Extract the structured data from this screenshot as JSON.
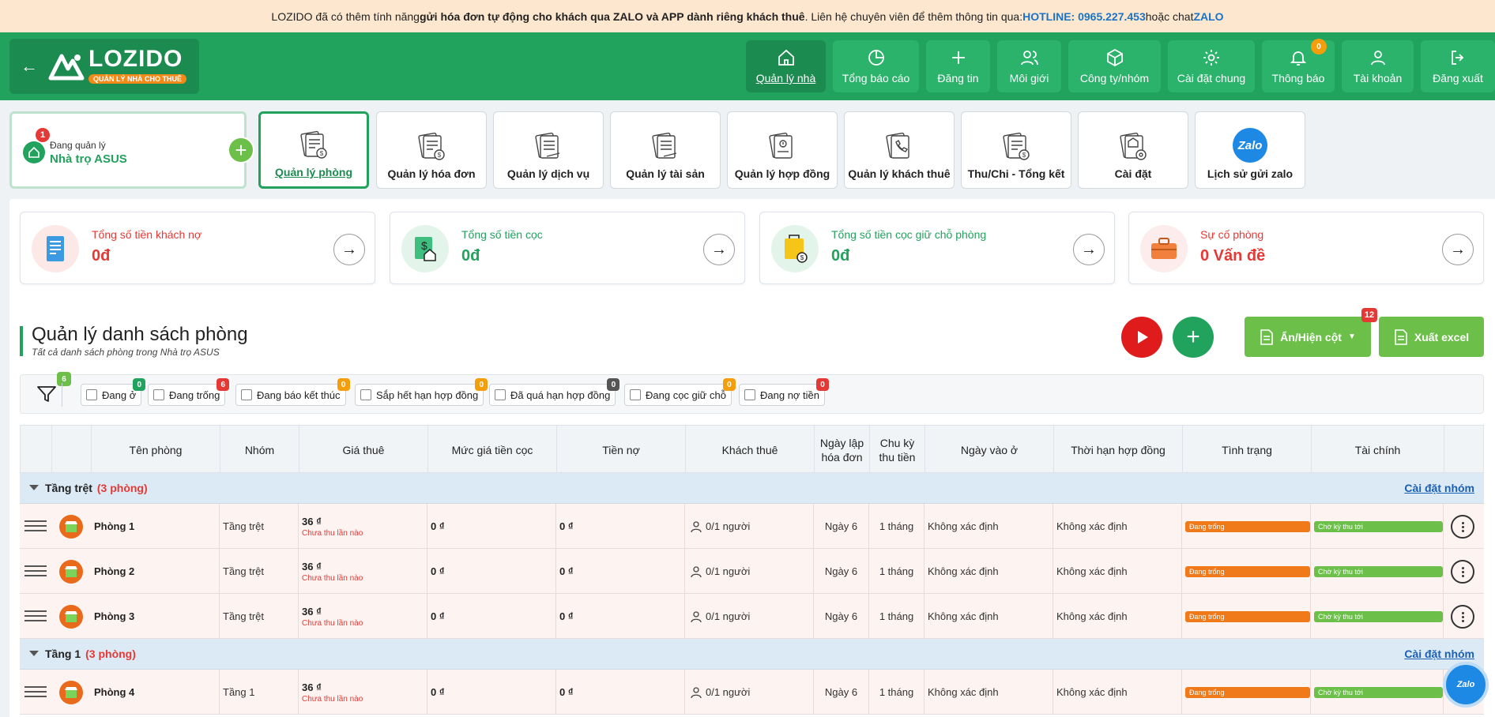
{
  "banner": {
    "prefix": "LOZIDO đã có thêm tính năng ",
    "bold": "gửi hóa đơn tự động cho khách qua ZALO và APP dành riêng khách thuê",
    "middle": ". Liên hệ chuyên viên để thêm thông tin qua: ",
    "hotline": "HOTLINE: 0965.227.453",
    "or": " hoặc chat ",
    "zalo": "ZALO"
  },
  "logo": {
    "name": "LOZIDO",
    "tagline": "QUẢN LÝ NHÀ CHO THUÊ"
  },
  "nav": [
    {
      "label": "Quản lý nhà",
      "icon": "home-icon"
    },
    {
      "label": "Tổng báo cáo",
      "icon": "pie-chart-icon"
    },
    {
      "label": "Đăng tin",
      "icon": "plus-icon"
    },
    {
      "label": "Môi giới",
      "icon": "users-icon"
    },
    {
      "label": "Công ty/nhóm",
      "icon": "box-icon"
    },
    {
      "label": "Cài đặt chung",
      "icon": "gear-icon"
    },
    {
      "label": "Thông báo",
      "icon": "bell-icon",
      "badge": "0"
    },
    {
      "label": "Tài khoản",
      "icon": "user-icon"
    },
    {
      "label": "Đăng xuất",
      "icon": "logout-icon"
    }
  ],
  "house": {
    "badge": "1",
    "sub": "Đang quản lý",
    "name": "Nhà trọ ASUS"
  },
  "tools": [
    {
      "label": "Quản lý phòng",
      "icon": "room-doc-icon"
    },
    {
      "label": "Quản lý hóa đơn",
      "icon": "invoice-icon"
    },
    {
      "label": "Quản lý dịch vụ",
      "icon": "service-icon"
    },
    {
      "label": "Quản lý tài sản",
      "icon": "asset-icon"
    },
    {
      "label": "Quản lý hợp đồng",
      "icon": "contract-icon"
    },
    {
      "label": "Quản lý khách thuê",
      "icon": "tenant-icon"
    },
    {
      "label": "Thu/Chi - Tổng kết",
      "icon": "finance-icon"
    },
    {
      "label": "Cài đặt",
      "icon": "settings-doc-icon"
    },
    {
      "label": "Lịch sử gửi zalo",
      "icon": "zalo-icon",
      "icon_text": "Zalo"
    }
  ],
  "stats": [
    {
      "title": "Tổng số tiền khách nợ",
      "value": "0đ",
      "color": "#e53935"
    },
    {
      "title": "Tổng số tiền cọc",
      "value": "0đ",
      "color": "#21a25d"
    },
    {
      "title": "Tổng số tiền cọc giữ chỗ phòng",
      "value": "0đ",
      "color": "#21a25d"
    },
    {
      "title": "Sự cố phòng",
      "value": "0 Vấn đề",
      "color": "#e53935"
    }
  ],
  "section": {
    "title": "Quản lý danh sách phòng",
    "subtitle": "Tất cả danh sách phòng trong Nhà trọ ASUS"
  },
  "actions": {
    "columns_label": "Ẩn/Hiện cột",
    "columns_badge": "12",
    "excel_label": "Xuất excel"
  },
  "filters": {
    "badge": "6",
    "chips": [
      {
        "label": "Đang ở",
        "count": "0",
        "color": "#21a25d"
      },
      {
        "label": "Đang trống",
        "count": "6",
        "color": "#e53935"
      },
      {
        "label": "Đang báo kết thúc",
        "count": "0",
        "color": "#f59e0b"
      },
      {
        "label": "Sắp hết hạn hợp đồng",
        "count": "0",
        "color": "#f59e0b"
      },
      {
        "label": "Đã quá hạn hợp đồng",
        "count": "0",
        "color": "#555555"
      },
      {
        "label": "Đang cọc giữ chỗ",
        "count": "0",
        "color": "#f59e0b"
      },
      {
        "label": "Đang nợ tiền",
        "count": "0",
        "color": "#e53935"
      }
    ]
  },
  "table": {
    "headers": [
      "Tên phòng",
      "Nhóm",
      "Giá thuê",
      "Mức giá tiền cọc",
      "Tiền nợ",
      "Khách thuê",
      "Ngày lập hóa đơn",
      "Chu kỳ thu tiền",
      "Ngày vào ở",
      "Thời hạn hợp đồng",
      "Tình trạng",
      "Tài chính"
    ],
    "group_setting_label": "Cài đặt nhóm",
    "groups": [
      {
        "name": "Tầng trệt",
        "count": "(3 phòng)",
        "rows": [
          {
            "name": "Phòng 1",
            "group": "Tầng trệt",
            "price": "36 ₫",
            "price_note": "Chưa thu lần nào",
            "deposit": "0 ₫",
            "debt": "0 ₫",
            "tenants": "0/1 người",
            "invoice_day": "Ngày 6",
            "cycle": "1 tháng",
            "move_in": "Không xác định",
            "term": "Không xác định",
            "status": "Đang trống",
            "finance": "Chờ kỳ thu tới"
          },
          {
            "name": "Phòng 2",
            "group": "Tầng trệt",
            "price": "36 ₫",
            "price_note": "Chưa thu lần nào",
            "deposit": "0 ₫",
            "debt": "0 ₫",
            "tenants": "0/1 người",
            "invoice_day": "Ngày 6",
            "cycle": "1 tháng",
            "move_in": "Không xác định",
            "term": "Không xác định",
            "status": "Đang trống",
            "finance": "Chờ kỳ thu tới"
          },
          {
            "name": "Phòng 3",
            "group": "Tầng trệt",
            "price": "36 ₫",
            "price_note": "Chưa thu lần nào",
            "deposit": "0 ₫",
            "debt": "0 ₫",
            "tenants": "0/1 người",
            "invoice_day": "Ngày 6",
            "cycle": "1 tháng",
            "move_in": "Không xác định",
            "term": "Không xác định",
            "status": "Đang trống",
            "finance": "Chờ kỳ thu tới"
          }
        ]
      },
      {
        "name": "Tầng 1",
        "count": "(3 phòng)",
        "rows": [
          {
            "name": "Phòng 4",
            "group": "Tầng 1",
            "price": "36 ₫",
            "price_note": "Chưa thu lần nào",
            "deposit": "0 ₫",
            "debt": "0 ₫",
            "tenants": "0/1 người",
            "invoice_day": "Ngày 6",
            "cycle": "1 tháng",
            "move_in": "Không xác định",
            "term": "Không xác định",
            "status": "Đang trống",
            "finance": "Chờ kỳ thu tới"
          }
        ]
      }
    ]
  },
  "zalo_float": "Zalo"
}
